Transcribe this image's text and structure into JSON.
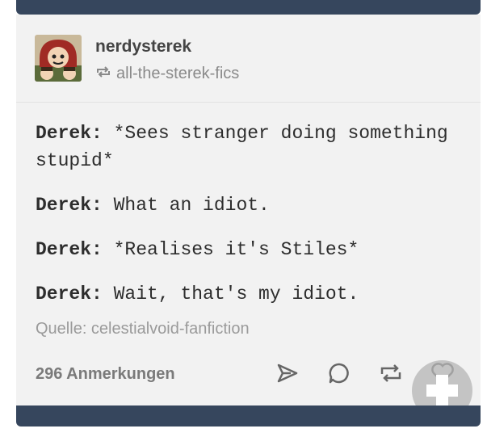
{
  "post": {
    "username": "nerdysterek",
    "reblogged_from": "all-the-sterek-fics",
    "lines": [
      {
        "speaker": "Derek:",
        "text": " *Sees stranger doing something stupid*"
      },
      {
        "speaker": "Derek:",
        "text": " What an idiot."
      },
      {
        "speaker": "Derek:",
        "text": " *Realises it's Stiles*"
      },
      {
        "speaker": "Derek:",
        "text": " Wait, that's my idiot."
      }
    ],
    "source": "Quelle: celestialvoid-fanfiction",
    "notes": "296 Anmerkungen"
  },
  "icons": {
    "reblog_small": "reblog-icon",
    "share": "send-icon",
    "reply": "comment-icon",
    "reblog": "reblog-icon",
    "like": "heart-icon"
  },
  "colors": {
    "dashboard_bar": "#36465d",
    "card_background": "#f2f2f2",
    "muted_text": "#8a8a8a"
  }
}
